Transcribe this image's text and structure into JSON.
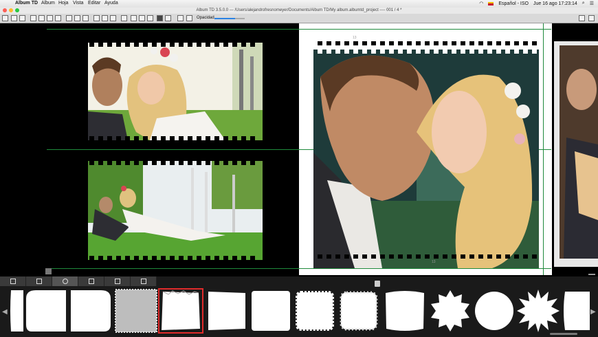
{
  "menubar": {
    "apple_symbol": "",
    "app_name": "Album TD",
    "items": [
      "Album",
      "Hoja",
      "Vista",
      "Editar",
      "Ayuda"
    ],
    "status": {
      "language": "Español - ISO",
      "datetime": "Jue 16 ago  17:23:14"
    }
  },
  "window": {
    "title": "Album TD 3.5.0.0 --- /Users/alejandrofresnomeyer/Documents/Album TD/My album.albumtd_project ---- 001 / 4 *"
  },
  "toolbar": {
    "opacity_label": "Opacidad"
  },
  "canvas": {
    "page_label_right_top": "13",
    "page_label_right_bottom": "13"
  },
  "colors": {
    "guide": "#1f8a3c",
    "selection": "#e12b2b",
    "slider": "#2a82e4"
  },
  "bottom_panel": {
    "tab_icons": [
      "frame-image-icon",
      "frame-single-icon",
      "frame-circle-icon",
      "frame-grid-icon",
      "frame-diagonal-icon",
      "frame-split-icon"
    ],
    "thumbnails": [
      "rounded-left",
      "rounded-tab",
      "rounded-tab-right",
      "texture-noise",
      "torn-edge-selected",
      "torn-edge",
      "brush-square",
      "scalloped-square",
      "lace-square",
      "wavy-square",
      "starburst-round",
      "rough-circle",
      "zigzag-star",
      "rough-square"
    ],
    "selected_thumbnail": "torn-edge-selected"
  }
}
